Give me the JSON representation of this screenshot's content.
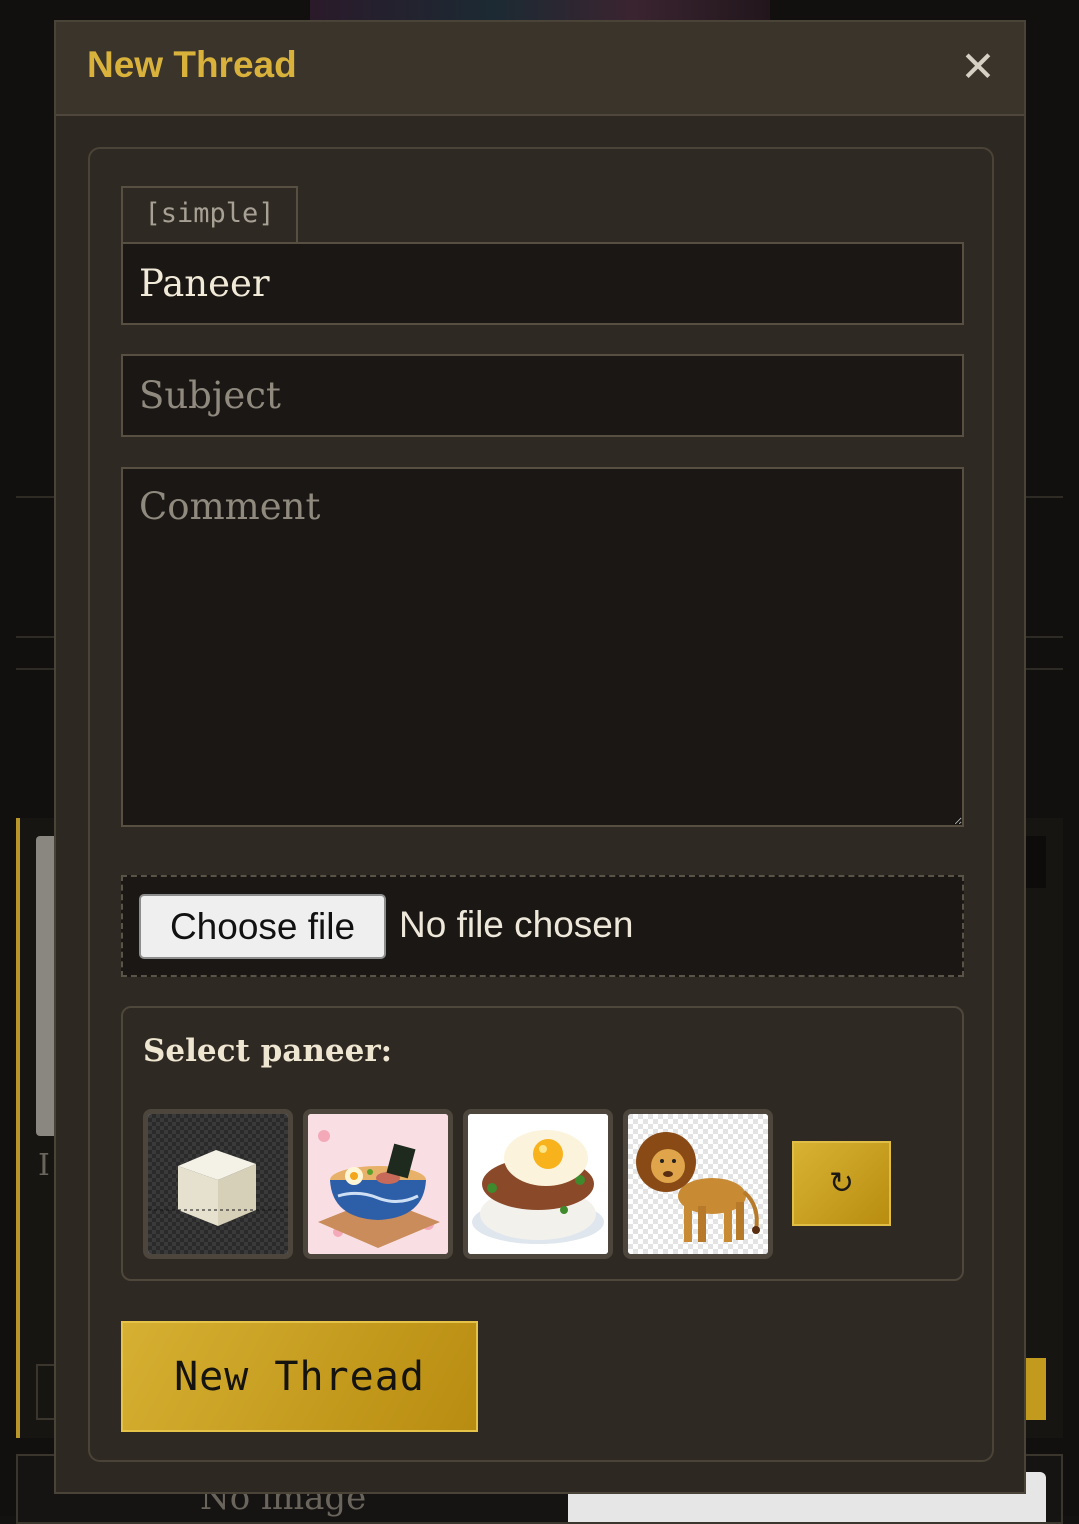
{
  "modal": {
    "title": "New Thread",
    "close_label": "✕"
  },
  "form": {
    "name_tag": "[simple]",
    "name_value": "Paneer",
    "subject_placeholder": "Subject",
    "comment_placeholder": "Comment",
    "file": {
      "button_label": "Choose file",
      "status": "No file chosen"
    },
    "paneer_picker": {
      "label": "Select paneer:",
      "options": [
        {
          "name": "paneer-cube-image"
        },
        {
          "name": "ramen-bowl-image"
        },
        {
          "name": "fried-egg-rice-image"
        },
        {
          "name": "lion-image"
        }
      ],
      "refresh_label": "↻"
    },
    "submit_label": "New Thread"
  },
  "background": {
    "no_image_text": "No image",
    "letter_text": "I"
  },
  "colors": {
    "accent_gold": "#d9b23c",
    "modal_bg": "#2e2822",
    "field_bg": "#1a1714"
  }
}
